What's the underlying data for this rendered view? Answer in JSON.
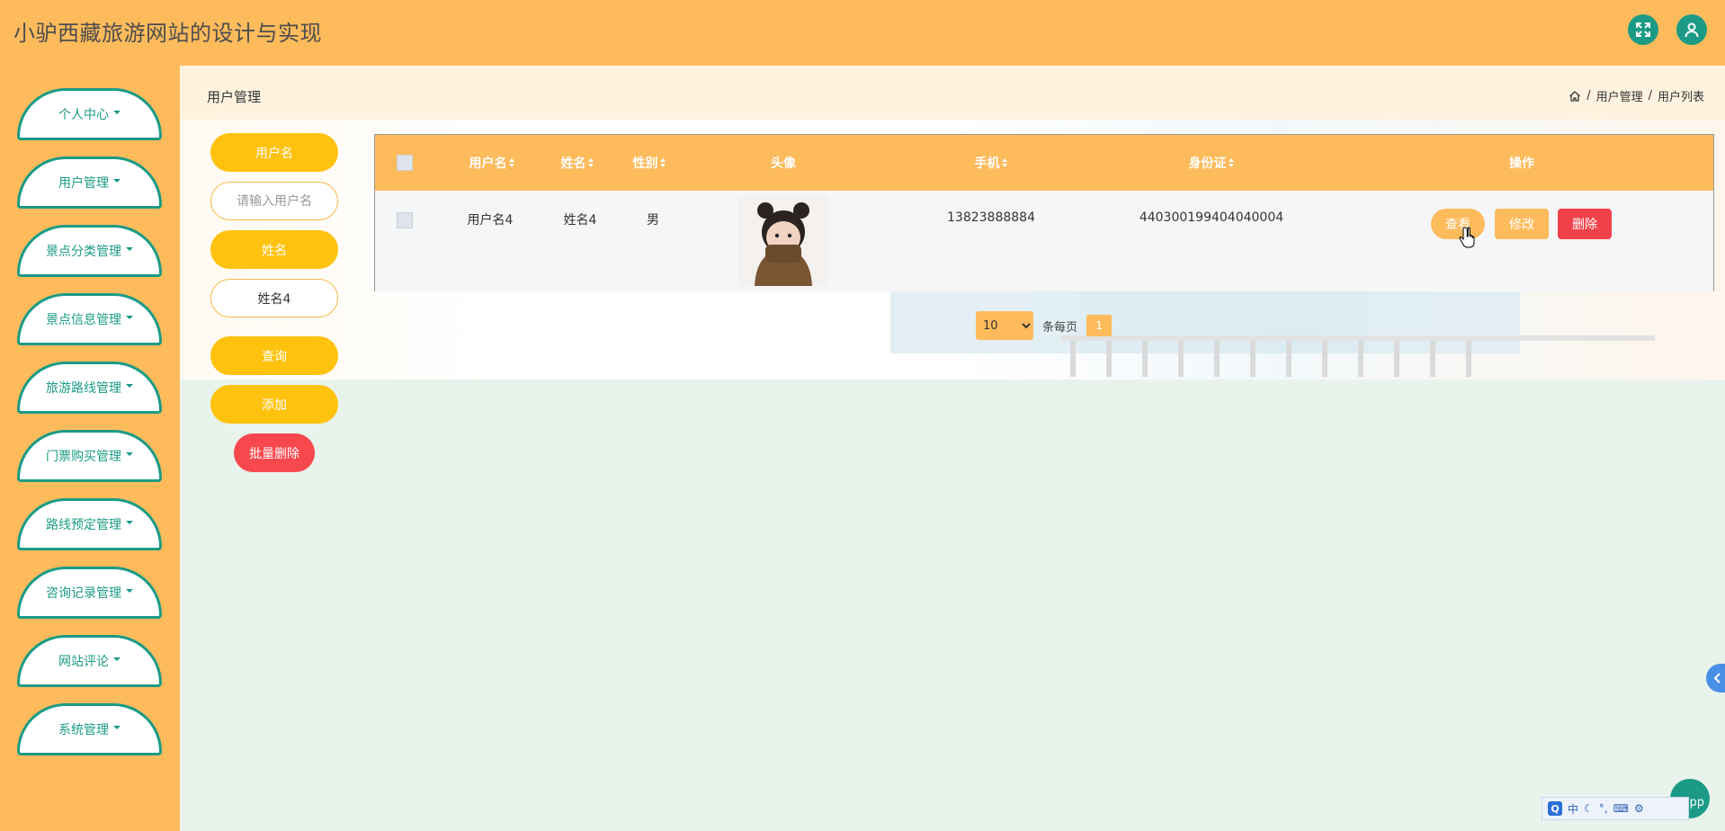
{
  "app": {
    "title": "小驴西藏旅游网站的设计与实现"
  },
  "sidebar": {
    "items": [
      {
        "label": "个人中心"
      },
      {
        "label": "用户管理"
      },
      {
        "label": "景点分类管理"
      },
      {
        "label": "景点信息管理"
      },
      {
        "label": "旅游路线管理"
      },
      {
        "label": "门票购买管理"
      },
      {
        "label": "路线预定管理"
      },
      {
        "label": "咨询记录管理"
      },
      {
        "label": "网站评论"
      },
      {
        "label": "系统管理"
      }
    ]
  },
  "page": {
    "title": "用户管理",
    "breadcrumb": [
      "用户管理",
      "用户列表"
    ],
    "breadcrumb_sep": "/"
  },
  "search": {
    "username_label": "用户名",
    "username_placeholder": "请输入用户名",
    "username_value": "",
    "name_label": "姓名",
    "name_value": "姓名4",
    "query_button": "查询",
    "add_button": "添加",
    "batch_delete_button": "批量删除"
  },
  "table": {
    "columns": [
      "用户名",
      "姓名",
      "性别",
      "头像",
      "手机",
      "身份证",
      "操作"
    ],
    "rows": [
      {
        "username": "用户名4",
        "name": "姓名4",
        "gender": "男",
        "phone": "13823888884",
        "id_card": "440300199404040004",
        "actions": {
          "view": "查看",
          "edit": "修改",
          "delete": "删除"
        }
      }
    ]
  },
  "pagination": {
    "page_size": "10",
    "page_size_options": [
      "10"
    ],
    "per_page_label": "条每页",
    "current_page": "1"
  },
  "widgets": {
    "app_bubble_text": "pp",
    "ime_text": "中"
  },
  "colors": {
    "header": "#fdbb5c",
    "accent": "#1b9b85",
    "button_yellow": "#ffc20e",
    "danger": "#f1424b"
  }
}
